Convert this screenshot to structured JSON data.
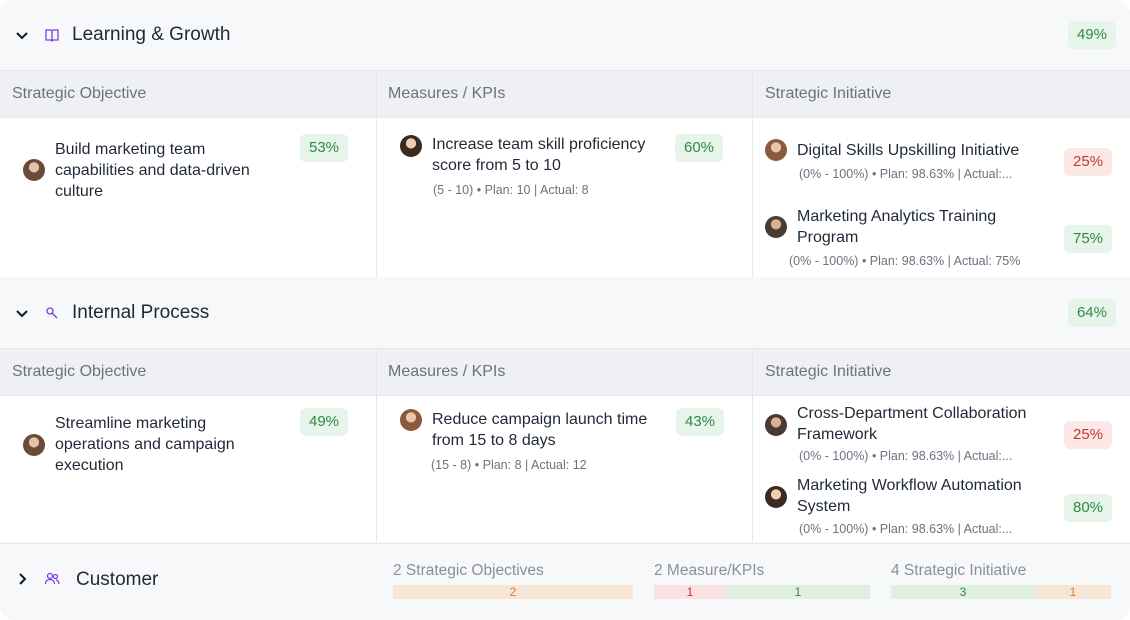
{
  "columns": {
    "objective": "Strategic Objective",
    "measures": "Measures / KPIs",
    "initiative": "Strategic Initiative"
  },
  "sections": [
    {
      "title": "Learning & Growth",
      "percent": "49%",
      "icon": "book-icon",
      "expanded": true,
      "objective": {
        "text": "Build marketing team capabilities and data-driven culture",
        "percent": "53%"
      },
      "kpi": {
        "text": "Increase team skill proficiency score from 5 to 10",
        "detail": "(5 - 10) • Plan: 10 | Actual: 8",
        "percent": "60%"
      },
      "initiatives": [
        {
          "text": "Digital Skills Upskilling Initiative",
          "detail": "(0% - 100%) • Plan: 98.63% | Actual:...",
          "percent": "25%",
          "status": "red"
        },
        {
          "text": "Marketing Analytics Training Program",
          "detail": "(0% - 100%) • Plan: 98.63% | Actual: 75%",
          "percent": "75%",
          "status": "green"
        }
      ]
    },
    {
      "title": "Internal Process",
      "percent": "64%",
      "icon": "process-icon",
      "expanded": true,
      "objective": {
        "text": "Streamline marketing operations and campaign execution",
        "percent": "49%"
      },
      "kpi": {
        "text": "Reduce campaign launch time from 15 to 8 days",
        "detail": "(15 - 8) • Plan: 8 |  Actual: 12",
        "percent": "43%"
      },
      "initiatives": [
        {
          "text": "Cross-Department Collaboration Framework",
          "detail": "(0% - 100%) • Plan: 98.63% | Actual:...",
          "percent": "25%",
          "status": "red"
        },
        {
          "text": "Marketing Workflow Automation System",
          "detail": "(0% - 100%) • Plan: 98.63% | Actual:...",
          "percent": "80%",
          "status": "green"
        }
      ]
    },
    {
      "title": "Customer",
      "icon": "users-icon",
      "expanded": false,
      "summary": {
        "objectives": {
          "label": "2 Strategic Objectives",
          "bars": [
            {
              "value": "2",
              "color": "orange"
            }
          ]
        },
        "kpis": {
          "label": "2 Measure/KPIs",
          "bars": [
            {
              "value": "1",
              "color": "red"
            },
            {
              "value": "1",
              "color": "green"
            }
          ]
        },
        "initiatives": {
          "label": "4 Strategic Initiative",
          "bars": [
            {
              "value": "3",
              "color": "green"
            },
            {
              "value": "1",
              "color": "orange"
            }
          ]
        }
      }
    }
  ],
  "colors": {
    "green_bg": "#e6f4ea",
    "green_fg": "#2f8a44",
    "red_bg": "#fde8e8",
    "red_fg": "#c0392b",
    "orange_bg": "#f6e6d6",
    "orange_fg": "#d97a2b",
    "accent": "#7c3aed"
  }
}
